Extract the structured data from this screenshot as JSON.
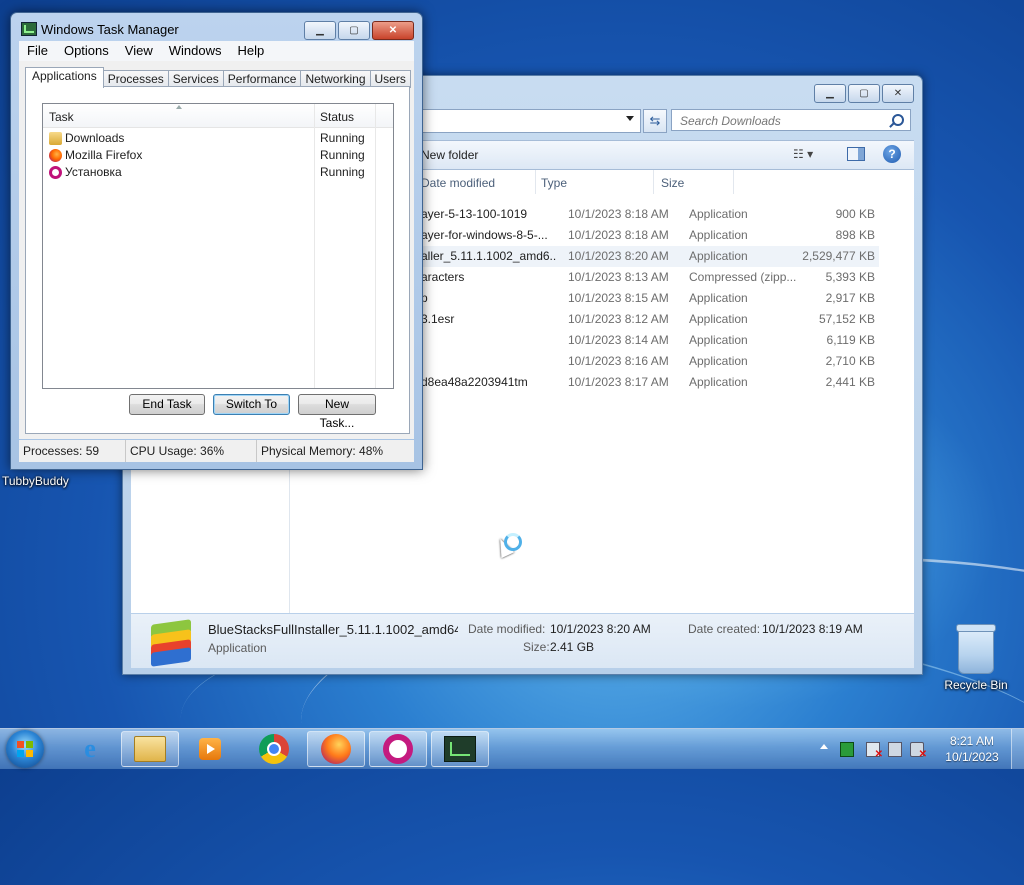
{
  "desktop": {
    "recycle_bin_label": "Recycle Bin",
    "partial_icon_label": "TubbyBuddy"
  },
  "explorer": {
    "search_placeholder": "Search Downloads",
    "toolbar_new_folder": "New folder",
    "views_label": "☷ ▾",
    "help_label": "?",
    "columns": {
      "date": "Date modified",
      "type": "Type",
      "size": "Size"
    },
    "files": [
      {
        "name": "ayer-5-13-100-1019",
        "date": "10/1/2023 8:18 AM",
        "type": "Application",
        "size": "900 KB"
      },
      {
        "name": "ayer-for-windows-8-5-...",
        "date": "10/1/2023 8:18 AM",
        "type": "Application",
        "size": "898 KB"
      },
      {
        "name": "aller_5.11.1.1002_amd6...",
        "date": "10/1/2023 8:20 AM",
        "type": "Application",
        "size": "2,529,477 KB"
      },
      {
        "name": "aracters",
        "date": "10/1/2023 8:13 AM",
        "type": "Compressed (zipp...",
        "size": "5,393 KB"
      },
      {
        "name": "p",
        "date": "10/1/2023 8:15 AM",
        "type": "Application",
        "size": "2,917 KB"
      },
      {
        "name": "3.1esr",
        "date": "10/1/2023 8:12 AM",
        "type": "Application",
        "size": "57,152 KB"
      },
      {
        "name": "",
        "date": "10/1/2023 8:14 AM",
        "type": "Application",
        "size": "6,119 KB"
      },
      {
        "name": "",
        "date": "10/1/2023 8:16 AM",
        "type": "Application",
        "size": "2,710 KB"
      },
      {
        "name": "d8ea48a2203941tm",
        "date": "10/1/2023 8:17 AM",
        "type": "Application",
        "size": "2,441 KB"
      }
    ],
    "selected_row": 2,
    "details": {
      "name": "BlueStacksFullInstaller_5.11.1.1002_amd64...",
      "type": "Application",
      "date_modified_label": "Date modified:",
      "date_modified": "10/1/2023 8:20 AM",
      "date_created_label": "Date created:",
      "date_created": "10/1/2023 8:19 AM",
      "size_label": "Size:",
      "size": "2.41 GB"
    }
  },
  "taskmgr": {
    "title": "Windows Task Manager",
    "menu": [
      "File",
      "Options",
      "View",
      "Windows",
      "Help"
    ],
    "tabs": [
      "Applications",
      "Processes",
      "Services",
      "Performance",
      "Networking",
      "Users"
    ],
    "active_tab": "Applications",
    "columns": {
      "task": "Task",
      "status": "Status"
    },
    "tasks": [
      {
        "task": "Downloads",
        "status": "Running",
        "icon": "folder-icon"
      },
      {
        "task": "Mozilla Firefox",
        "status": "Running",
        "icon": "firefox-icon"
      },
      {
        "task": "Установка",
        "status": "Running",
        "icon": "opera-icon"
      }
    ],
    "buttons": {
      "end_task": "End Task",
      "switch_to": "Switch To",
      "new_task": "New Task..."
    },
    "status": {
      "processes": "Processes: 59",
      "cpu": "CPU Usage: 36%",
      "memory": "Physical Memory: 48%"
    }
  },
  "taskbar": {
    "clock_time": "8:21 AM",
    "clock_date": "10/1/2023",
    "apps": [
      "internet-explorer",
      "windows-explorer",
      "media-player",
      "chrome",
      "firefox",
      "opera",
      "task-manager"
    ]
  },
  "colors": {
    "selection_bg": "#eef3f9",
    "accent": "#3c7fb1"
  }
}
